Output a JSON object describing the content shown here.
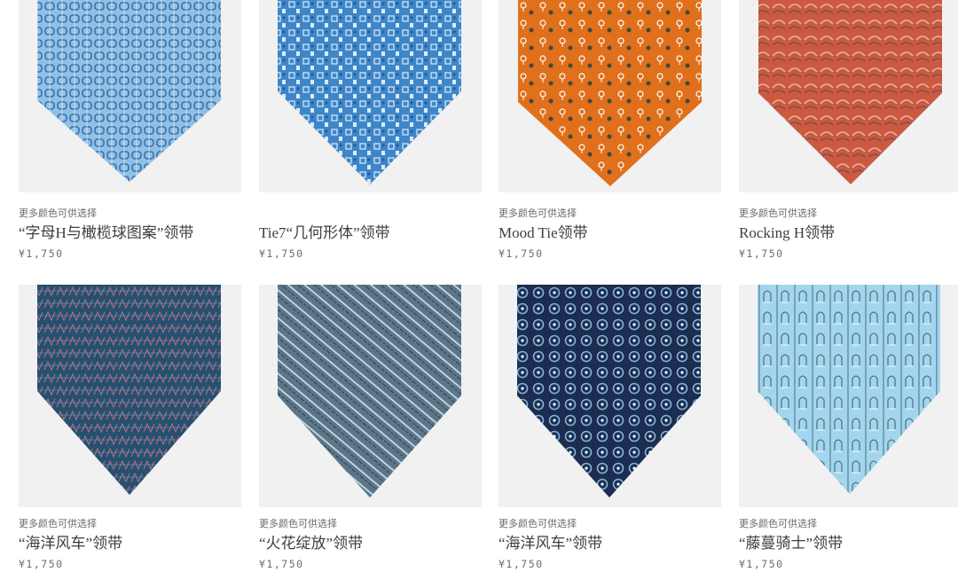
{
  "products": [
    {
      "more_colors": "更多颜色可供选择",
      "name": "“字母H与橄榄球图案”领带",
      "price": "¥1,750",
      "color": "#8fc0e6",
      "pattern_color": "#3d6fa8",
      "accent": "#e8f2fb"
    },
    {
      "more_colors": "",
      "name": "Tie7“几何形体”领带",
      "price": "¥1,750",
      "color": "#3f86c8",
      "pattern_color": "#d9ecfa",
      "accent": "#1f5f9c"
    },
    {
      "more_colors": "更多颜色可供选择",
      "name": "Mood Tie领带",
      "price": "¥1,750",
      "color": "#e0701c",
      "pattern_color": "#ffffff",
      "accent": "#3d4a3c"
    },
    {
      "more_colors": "更多颜色可供选择",
      "name": "Rocking H领带",
      "price": "¥1,750",
      "color": "#cc5a40",
      "pattern_color": "#e9b7a4",
      "accent": "#4b4f58"
    },
    {
      "more_colors": "更多颜色可供选择",
      "name": "“海洋风车”领带",
      "price": "¥1,750",
      "color": "#25516f",
      "pattern_color": "#c26a86",
      "accent": "#5e9cc0"
    },
    {
      "more_colors": "更多颜色可供选择",
      "name": "“火花绽放”领带",
      "price": "¥1,750",
      "color": "#5c7688",
      "pattern_color": "#c4dcea",
      "accent": "#2c3e4d"
    },
    {
      "more_colors": "更多颜色可供选择",
      "name": "“海洋风车”领带",
      "price": "¥1,750",
      "color": "#1c2d50",
      "pattern_color": "#7fb3de",
      "accent": "#ffffff"
    },
    {
      "more_colors": "更多颜色可供选择",
      "name": "“藤蔓骑士”领带",
      "price": "¥1,750",
      "color": "#a3d6ee",
      "pattern_color": "#49707e",
      "accent": "#e4f4fb"
    }
  ]
}
